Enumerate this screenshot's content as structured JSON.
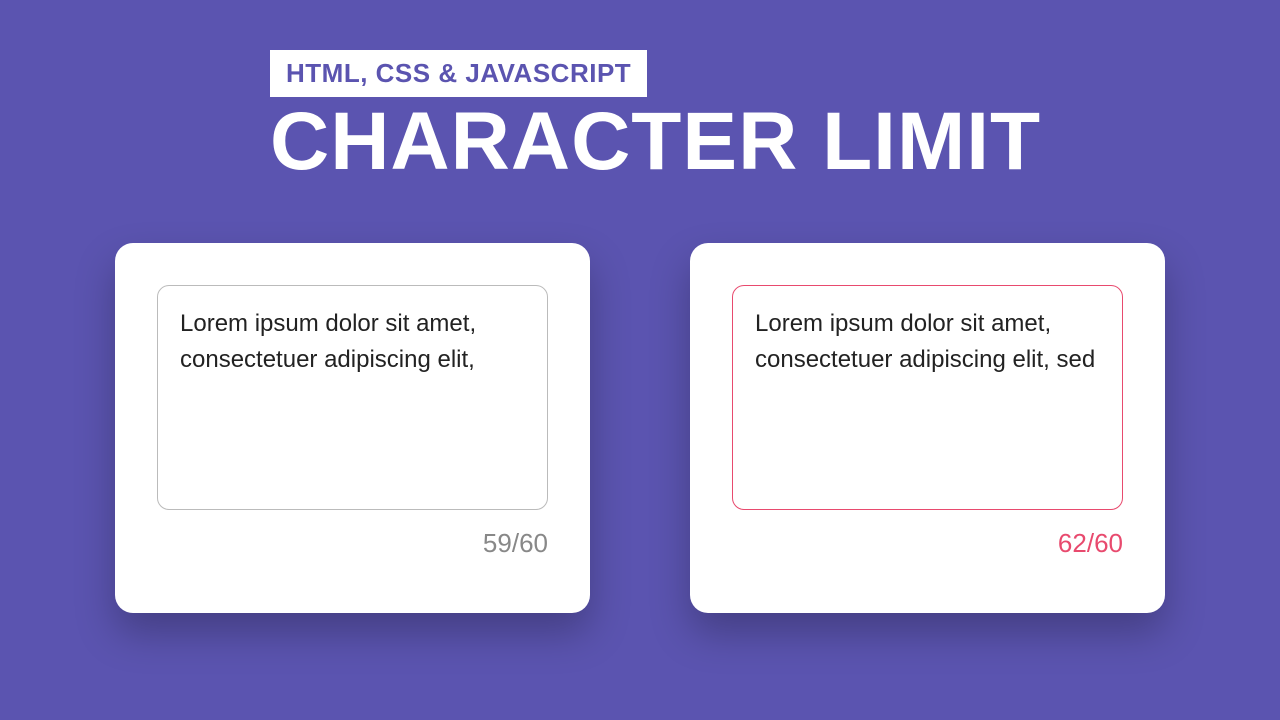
{
  "header": {
    "subtitle": "HTML, CSS & JAVASCRIPT",
    "title": "CHARACTER LIMIT"
  },
  "cards": [
    {
      "text": "Lorem ipsum dolor sit amet, consectetuer adipiscing elit,",
      "counter": "59/60",
      "error": false
    },
    {
      "text": "Lorem ipsum dolor sit amet, consectetuer adipiscing elit, sed",
      "counter": "62/60",
      "error": true
    }
  ]
}
